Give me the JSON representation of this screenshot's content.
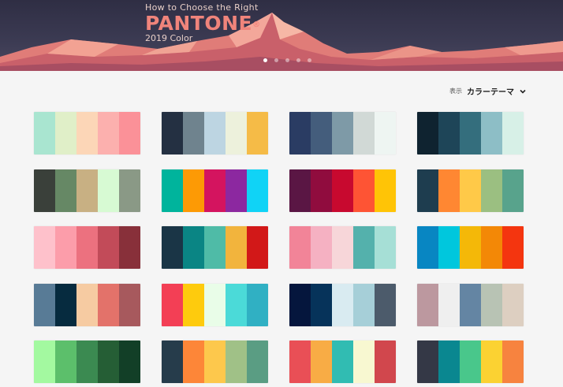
{
  "hero": {
    "subtitle": "How to Choose the Right",
    "brand": "PANTONE",
    "trademark": "®",
    "year": "2019 Color",
    "dot_count": 5,
    "active_dot": 0
  },
  "toolbar": {
    "label": "表示",
    "value": "カラーテーマ"
  },
  "palettes": [
    [
      "#a9e5d0",
      "#e0efc8",
      "#fcd6b7",
      "#fcb0ae",
      "#fb9198"
    ],
    [
      "#243042",
      "#6f838e",
      "#bdd5e2",
      "#edf1dc",
      "#f5bb47"
    ],
    [
      "#2a3c63",
      "#445d7c",
      "#7e9aa7",
      "#d1d9d6",
      "#eef5f2"
    ],
    [
      "#0f2330",
      "#1e4558",
      "#346e7d",
      "#8dbec6",
      "#d7f0e7"
    ],
    [
      "#3a403a",
      "#668865",
      "#c8b083",
      "#d7fad3",
      "#8a9986"
    ],
    [
      "#00b49c",
      "#fd9a05",
      "#d4145f",
      "#8c28a0",
      "#10d3f6"
    ],
    [
      "#5a1644",
      "#900c3e",
      "#c8092f",
      "#fe5434",
      "#ffc406"
    ],
    [
      "#1e3d4f",
      "#ff8732",
      "#ffc948",
      "#9bbf81",
      "#58a38c"
    ],
    [
      "#fec1cb",
      "#fc9daa",
      "#ec717f",
      "#c24b59",
      "#88303a"
    ],
    [
      "#1a3546",
      "#0a8584",
      "#4fbba7",
      "#f2b43d",
      "#d21818"
    ],
    [
      "#f28498",
      "#f5b1c2",
      "#f7d6d9",
      "#54b1ac",
      "#a6dfd6"
    ],
    [
      "#0886c2",
      "#00c7dd",
      "#f4b808",
      "#f38806",
      "#f4350f"
    ],
    [
      "#587b96",
      "#062b3f",
      "#f6cba2",
      "#e3726a",
      "#a7595d"
    ],
    [
      "#f33f55",
      "#fecb0d",
      "#e9fde8",
      "#4bdad8",
      "#30b0c3"
    ],
    [
      "#05163d",
      "#06335a",
      "#d9ebf1",
      "#a6cfd8",
      "#4c5b6b"
    ],
    [
      "#bc989f",
      "#efefef",
      "#6485a3",
      "#b8c3b4",
      "#ddcfc1"
    ],
    [
      "#a3f9a0",
      "#5cbf6b",
      "#3b8a51",
      "#255e35",
      "#123f27"
    ],
    [
      "#263c4b",
      "#fd8638",
      "#fdc84c",
      "#a0c187",
      "#5a9d83"
    ],
    [
      "#e94f56",
      "#f8ac45",
      "#31bcb2",
      "#f8f8d1",
      "#d1474d"
    ],
    [
      "#343846",
      "#0a8790",
      "#49c78b",
      "#fbd232",
      "#f7833f"
    ]
  ],
  "colors": {
    "background": "#f5f5f5",
    "brand": "#f0847b",
    "hero_bg": "#2f2e44"
  }
}
